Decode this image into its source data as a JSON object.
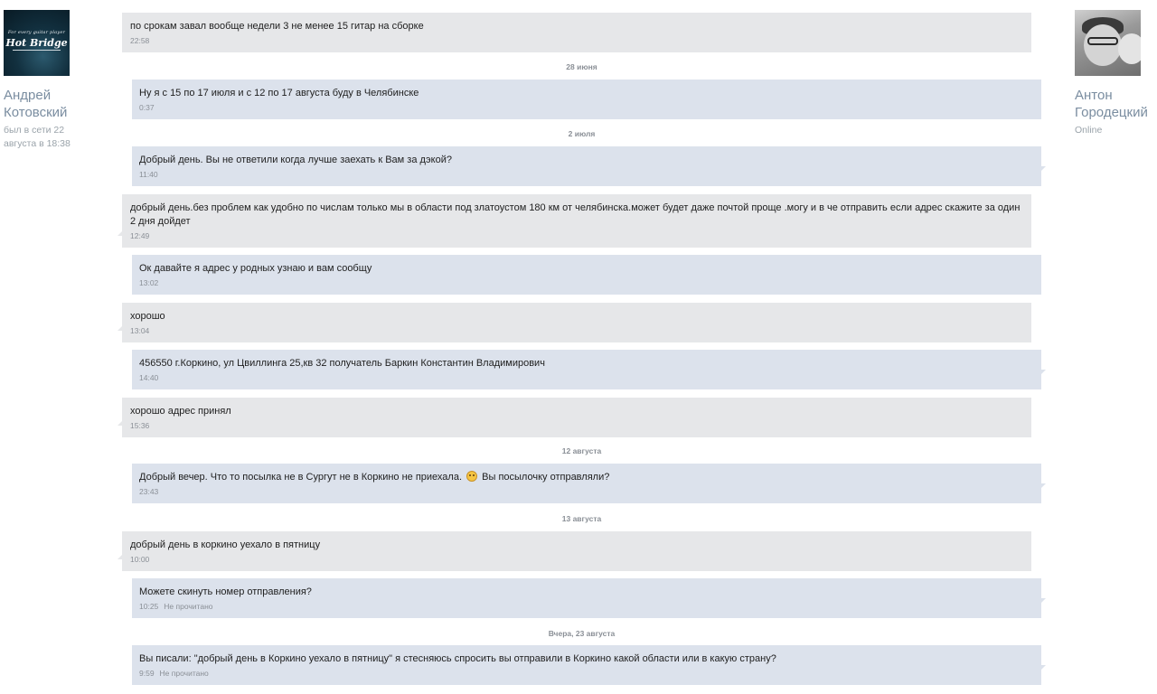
{
  "contact_left": {
    "name_line1": "Андрей",
    "name_line2": "Котовский",
    "status_line1": "был в сети 22",
    "status_line2": "августа в 18:38",
    "avatar_brand_top": "For every guitar player",
    "avatar_brand": "Hot Bridge"
  },
  "contact_right": {
    "name_line1": "Антон",
    "name_line2": "Городецкий",
    "status": "Online"
  },
  "messages": [
    {
      "text": "по срокам завал вообще недели 3 не менее 15 гитар на сборке",
      "time": "22:58"
    },
    {
      "text": "Ну я с 15 по 17 июля и с 12 по 17 августа буду в Челябинске",
      "time": "0:37"
    },
    {
      "text": "Добрый день. Вы не ответили когда лучше заехать к Вам за дэкой?",
      "time": "11:40"
    },
    {
      "text": "добрый день.без проблем как удобно по числам только мы в области под златоустом 180 км от челябинска.может будет даже почтой проще .могу и в че отправить если адрес скажите за один 2 дня дойдет",
      "time": "12:49"
    },
    {
      "text": "Ок давайте я адрес у родных узнаю и вам сообщу",
      "time": "13:02"
    },
    {
      "text": "хорошо",
      "time": "13:04"
    },
    {
      "text": "456550 г.Коркино, ул Цвиллинга 25,кв 32 получатель Баркин Константин Владимирович",
      "time": "14:40"
    },
    {
      "text": "хорошо адрес принял",
      "time": "15:36"
    },
    {
      "text_before": "Добрый вечер. Что то посылка не в Сургут не в Коркино не приехала.",
      "text_after": "Вы посылочку отправляли?",
      "time": "23:43"
    },
    {
      "text": "добрый день в коркино уехало в пятницу",
      "time": "10:00"
    },
    {
      "text": "Можете скинуть номер отправления?",
      "time": "10:25",
      "status": "Не прочитано"
    },
    {
      "text": "Вы писали: \"добрый день в Коркино уехало в пятницу\" я стесняюсь спросить вы отправили в Коркино какой области или в какую страну?",
      "time": "9:59",
      "status": "Не прочитано"
    }
  ],
  "dates": {
    "d1": "28 июня",
    "d2": "2 июля",
    "d3": "12 августа",
    "d4": "13 августа",
    "d5": "Вчера, 23 августа"
  },
  "emoji_icon": "sad-face-emoji"
}
